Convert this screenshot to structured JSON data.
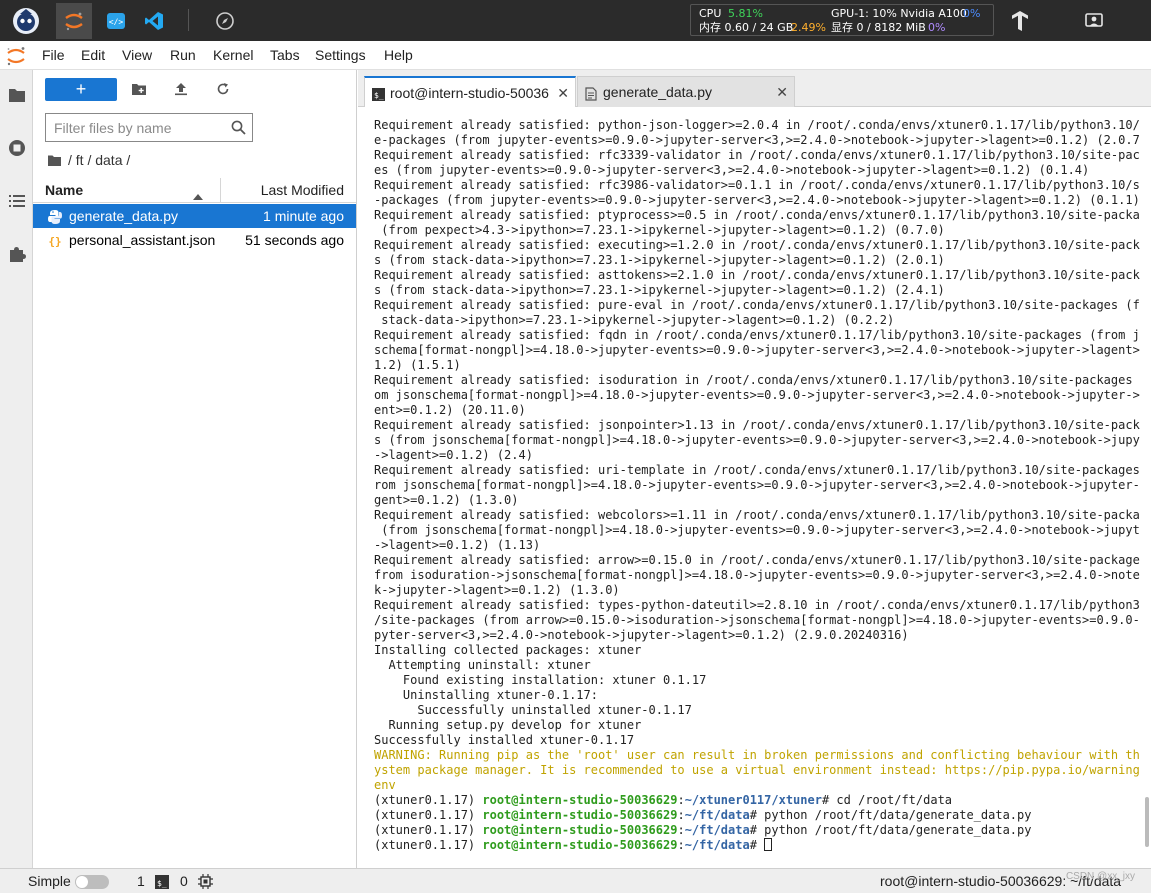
{
  "resources": {
    "cpu_label": "CPU",
    "cpu_value": "5.81%",
    "mem_label": "内存 0.60 / 24 GB",
    "mem_value": "2.49%",
    "gpu_label": "GPU-1: 10% Nvidia A100",
    "gpu_value": "0%",
    "vram_label": "显存 0 / 8182 MiB",
    "vram_value": "0%"
  },
  "menu": [
    "File",
    "Edit",
    "View",
    "Run",
    "Kernel",
    "Tabs",
    "Settings",
    "Help"
  ],
  "filebrowser": {
    "new_label": "+",
    "filter_placeholder": "Filter files by name",
    "breadcrumb": "/ ft / data /",
    "col_name": "Name",
    "col_modified": "Last Modified",
    "files": [
      {
        "name": "generate_data.py",
        "modified": "1 minute ago"
      },
      {
        "name": "personal_assistant.json",
        "modified": "51 seconds ago"
      }
    ]
  },
  "tabs": [
    {
      "label": "root@intern-studio-50036",
      "close": "✕"
    },
    {
      "label": "generate_data.py",
      "close": "✕"
    }
  ],
  "tab_add": "+",
  "terminal": {
    "lines": [
      "Requirement already satisfied: python-json-logger>=2.0.4 in /root/.conda/envs/xtuner0.1.17/lib/python3.10/sit",
      "e-packages (from jupyter-events>=0.9.0->jupyter-server<3,>=2.4.0->notebook->jupyter->lagent>=0.1.2) (2.0.7)",
      "Requirement already satisfied: rfc3339-validator in /root/.conda/envs/xtuner0.1.17/lib/python3.10/site-packag",
      "es (from jupyter-events>=0.9.0->jupyter-server<3,>=2.4.0->notebook->jupyter->lagent>=0.1.2) (0.1.4)",
      "Requirement already satisfied: rfc3986-validator>=0.1.1 in /root/.conda/envs/xtuner0.1.17/lib/python3.10/site",
      "-packages (from jupyter-events>=0.9.0->jupyter-server<3,>=2.4.0->notebook->jupyter->lagent>=0.1.2) (0.1.1)",
      "Requirement already satisfied: ptyprocess>=0.5 in /root/.conda/envs/xtuner0.1.17/lib/python3.10/site-packages",
      " (from pexpect>4.3->ipython>=7.23.1->ipykernel->jupyter->lagent>=0.1.2) (0.7.0)",
      "Requirement already satisfied: executing>=1.2.0 in /root/.conda/envs/xtuner0.1.17/lib/python3.10/site-package",
      "s (from stack-data->ipython>=7.23.1->ipykernel->jupyter->lagent>=0.1.2) (2.0.1)",
      "Requirement already satisfied: asttokens>=2.1.0 in /root/.conda/envs/xtuner0.1.17/lib/python3.10/site-package",
      "s (from stack-data->ipython>=7.23.1->ipykernel->jupyter->lagent>=0.1.2) (2.4.1)",
      "Requirement already satisfied: pure-eval in /root/.conda/envs/xtuner0.1.17/lib/python3.10/site-packages (from",
      " stack-data->ipython>=7.23.1->ipykernel->jupyter->lagent>=0.1.2) (0.2.2)",
      "Requirement already satisfied: fqdn in /root/.conda/envs/xtuner0.1.17/lib/python3.10/site-packages (from json",
      "schema[format-nongpl]>=4.18.0->jupyter-events>=0.9.0->jupyter-server<3,>=2.4.0->notebook->jupyter->lagent>=0.",
      "1.2) (1.5.1)",
      "Requirement already satisfied: isoduration in /root/.conda/envs/xtuner0.1.17/lib/python3.10/site-packages (fr",
      "om jsonschema[format-nongpl]>=4.18.0->jupyter-events>=0.9.0->jupyter-server<3,>=2.4.0->notebook->jupyter->lag",
      "ent>=0.1.2) (20.11.0)",
      "Requirement already satisfied: jsonpointer>1.13 in /root/.conda/envs/xtuner0.1.17/lib/python3.10/site-package",
      "s (from jsonschema[format-nongpl]>=4.18.0->jupyter-events>=0.9.0->jupyter-server<3,>=2.4.0->notebook->jupyter",
      "->lagent>=0.1.2) (2.4)",
      "Requirement already satisfied: uri-template in /root/.conda/envs/xtuner0.1.17/lib/python3.10/site-packages (f",
      "rom jsonschema[format-nongpl]>=4.18.0->jupyter-events>=0.9.0->jupyter-server<3,>=2.4.0->notebook->jupyter->la",
      "gent>=0.1.2) (1.3.0)",
      "Requirement already satisfied: webcolors>=1.11 in /root/.conda/envs/xtuner0.1.17/lib/python3.10/site-packages",
      " (from jsonschema[format-nongpl]>=4.18.0->jupyter-events>=0.9.0->jupyter-server<3,>=2.4.0->notebook->jupyter",
      "->lagent>=0.1.2) (1.13)",
      "Requirement already satisfied: arrow>=0.15.0 in /root/.conda/envs/xtuner0.1.17/lib/python3.10/site-packages (",
      "from isoduration->jsonschema[format-nongpl]>=4.18.0->jupyter-events>=0.9.0->jupyter-server<3,>=2.4.0->noteboo",
      "k->jupyter->lagent>=0.1.2) (1.3.0)",
      "Requirement already satisfied: types-python-dateutil>=2.8.10 in /root/.conda/envs/xtuner0.1.17/lib/python3.10",
      "/site-packages (from arrow>=0.15.0->isoduration->jsonschema[format-nongpl]>=4.18.0->jupyter-events>=0.9.0->ju",
      "pyter-server<3,>=2.4.0->notebook->jupyter->lagent>=0.1.2) (2.9.0.20240316)",
      "Installing collected packages: xtuner",
      "  Attempting uninstall: xtuner",
      "    Found existing installation: xtuner 0.1.17",
      "    Uninstalling xtuner-0.1.17:",
      "      Successfully uninstalled xtuner-0.1.17",
      "  Running setup.py develop for xtuner",
      "Successfully installed xtuner-0.1.17"
    ],
    "warning_lines": [
      "WARNING: Running pip as the 'root' user can result in broken permissions and conflicting behaviour with the s",
      "ystem package manager. It is recommended to use a virtual environment instead: https://pip.pypa.io/warnings/v",
      "env"
    ],
    "prompts": [
      {
        "env": "(xtuner0.1.17) ",
        "user": "root@intern-studio-50036629",
        "colon": ":",
        "path": "~/xtuner0117/xtuner",
        "cmd": "# cd /root/ft/data"
      },
      {
        "env": "(xtuner0.1.17) ",
        "user": "root@intern-studio-50036629",
        "colon": ":",
        "path": "~/ft/data",
        "cmd": "# python /root/ft/data/generate_data.py"
      },
      {
        "env": "(xtuner0.1.17) ",
        "user": "root@intern-studio-50036629",
        "colon": ":",
        "path": "~/ft/data",
        "cmd": "# python /root/ft/data/generate_data.py"
      },
      {
        "env": "(xtuner0.1.17) ",
        "user": "root@intern-studio-50036629",
        "colon": ":",
        "path": "~/ft/data",
        "cmd": "# "
      }
    ]
  },
  "statusbar": {
    "mode": "Simple",
    "terminals_count": "1",
    "kernels_count": "0",
    "right_text": "root@intern-studio-50036629: ~/ft/data",
    "watermark": "CSDN @xx_jxy"
  },
  "colors": {
    "accent": "#1976d2",
    "topbar": "#2b2b2b",
    "prompt_user": "#2f9c1d",
    "prompt_path": "#3465a4",
    "warning": "#c0a300"
  }
}
